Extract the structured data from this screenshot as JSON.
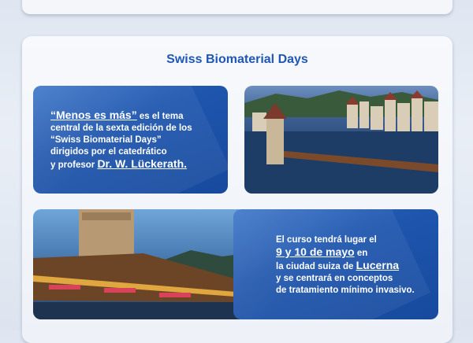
{
  "section_title": "Swiss Biomaterial Days",
  "intro": {
    "quote": "“Menos es más”",
    "l1_rest": " es el tema",
    "l2": "central de la sexta edición de los",
    "l3": "“Swiss Biomaterial Days”",
    "l4": "dirigidos por el catedrático",
    "l5_pre": "y profesor ",
    "speaker": "Dr. W. Lückerath."
  },
  "details": {
    "l1": "El curso tendrá lugar el",
    "dates": "9 y 10 de mayo",
    "l2_rest": " en",
    "l3_pre": "la ciudad suiza de ",
    "city": "Lucerna",
    "l4": "y se centrará en conceptos",
    "l5": "de tratamiento mínimo invasivo."
  }
}
